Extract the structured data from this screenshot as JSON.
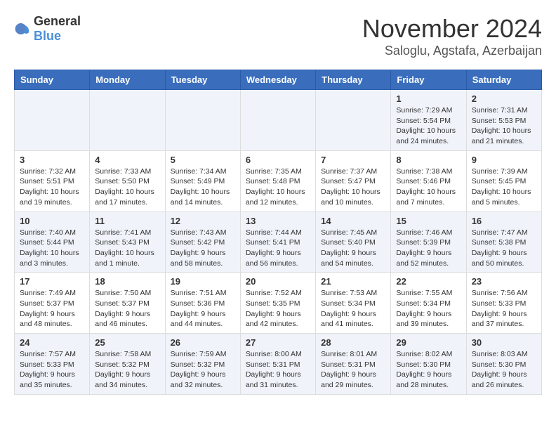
{
  "header": {
    "logo_general": "General",
    "logo_blue": "Blue",
    "month_title": "November 2024",
    "location": "Saloglu, Agstafa, Azerbaijan"
  },
  "days_of_week": [
    "Sunday",
    "Monday",
    "Tuesday",
    "Wednesday",
    "Thursday",
    "Friday",
    "Saturday"
  ],
  "weeks": [
    [
      {
        "day": "",
        "info": ""
      },
      {
        "day": "",
        "info": ""
      },
      {
        "day": "",
        "info": ""
      },
      {
        "day": "",
        "info": ""
      },
      {
        "day": "",
        "info": ""
      },
      {
        "day": "1",
        "info": "Sunrise: 7:29 AM\nSunset: 5:54 PM\nDaylight: 10 hours and 24 minutes."
      },
      {
        "day": "2",
        "info": "Sunrise: 7:31 AM\nSunset: 5:53 PM\nDaylight: 10 hours and 21 minutes."
      }
    ],
    [
      {
        "day": "3",
        "info": "Sunrise: 7:32 AM\nSunset: 5:51 PM\nDaylight: 10 hours and 19 minutes."
      },
      {
        "day": "4",
        "info": "Sunrise: 7:33 AM\nSunset: 5:50 PM\nDaylight: 10 hours and 17 minutes."
      },
      {
        "day": "5",
        "info": "Sunrise: 7:34 AM\nSunset: 5:49 PM\nDaylight: 10 hours and 14 minutes."
      },
      {
        "day": "6",
        "info": "Sunrise: 7:35 AM\nSunset: 5:48 PM\nDaylight: 10 hours and 12 minutes."
      },
      {
        "day": "7",
        "info": "Sunrise: 7:37 AM\nSunset: 5:47 PM\nDaylight: 10 hours and 10 minutes."
      },
      {
        "day": "8",
        "info": "Sunrise: 7:38 AM\nSunset: 5:46 PM\nDaylight: 10 hours and 7 minutes."
      },
      {
        "day": "9",
        "info": "Sunrise: 7:39 AM\nSunset: 5:45 PM\nDaylight: 10 hours and 5 minutes."
      }
    ],
    [
      {
        "day": "10",
        "info": "Sunrise: 7:40 AM\nSunset: 5:44 PM\nDaylight: 10 hours and 3 minutes."
      },
      {
        "day": "11",
        "info": "Sunrise: 7:41 AM\nSunset: 5:43 PM\nDaylight: 10 hours and 1 minute."
      },
      {
        "day": "12",
        "info": "Sunrise: 7:43 AM\nSunset: 5:42 PM\nDaylight: 9 hours and 58 minutes."
      },
      {
        "day": "13",
        "info": "Sunrise: 7:44 AM\nSunset: 5:41 PM\nDaylight: 9 hours and 56 minutes."
      },
      {
        "day": "14",
        "info": "Sunrise: 7:45 AM\nSunset: 5:40 PM\nDaylight: 9 hours and 54 minutes."
      },
      {
        "day": "15",
        "info": "Sunrise: 7:46 AM\nSunset: 5:39 PM\nDaylight: 9 hours and 52 minutes."
      },
      {
        "day": "16",
        "info": "Sunrise: 7:47 AM\nSunset: 5:38 PM\nDaylight: 9 hours and 50 minutes."
      }
    ],
    [
      {
        "day": "17",
        "info": "Sunrise: 7:49 AM\nSunset: 5:37 PM\nDaylight: 9 hours and 48 minutes."
      },
      {
        "day": "18",
        "info": "Sunrise: 7:50 AM\nSunset: 5:37 PM\nDaylight: 9 hours and 46 minutes."
      },
      {
        "day": "19",
        "info": "Sunrise: 7:51 AM\nSunset: 5:36 PM\nDaylight: 9 hours and 44 minutes."
      },
      {
        "day": "20",
        "info": "Sunrise: 7:52 AM\nSunset: 5:35 PM\nDaylight: 9 hours and 42 minutes."
      },
      {
        "day": "21",
        "info": "Sunrise: 7:53 AM\nSunset: 5:34 PM\nDaylight: 9 hours and 41 minutes."
      },
      {
        "day": "22",
        "info": "Sunrise: 7:55 AM\nSunset: 5:34 PM\nDaylight: 9 hours and 39 minutes."
      },
      {
        "day": "23",
        "info": "Sunrise: 7:56 AM\nSunset: 5:33 PM\nDaylight: 9 hours and 37 minutes."
      }
    ],
    [
      {
        "day": "24",
        "info": "Sunrise: 7:57 AM\nSunset: 5:33 PM\nDaylight: 9 hours and 35 minutes."
      },
      {
        "day": "25",
        "info": "Sunrise: 7:58 AM\nSunset: 5:32 PM\nDaylight: 9 hours and 34 minutes."
      },
      {
        "day": "26",
        "info": "Sunrise: 7:59 AM\nSunset: 5:32 PM\nDaylight: 9 hours and 32 minutes."
      },
      {
        "day": "27",
        "info": "Sunrise: 8:00 AM\nSunset: 5:31 PM\nDaylight: 9 hours and 31 minutes."
      },
      {
        "day": "28",
        "info": "Sunrise: 8:01 AM\nSunset: 5:31 PM\nDaylight: 9 hours and 29 minutes."
      },
      {
        "day": "29",
        "info": "Sunrise: 8:02 AM\nSunset: 5:30 PM\nDaylight: 9 hours and 28 minutes."
      },
      {
        "day": "30",
        "info": "Sunrise: 8:03 AM\nSunset: 5:30 PM\nDaylight: 9 hours and 26 minutes."
      }
    ]
  ]
}
